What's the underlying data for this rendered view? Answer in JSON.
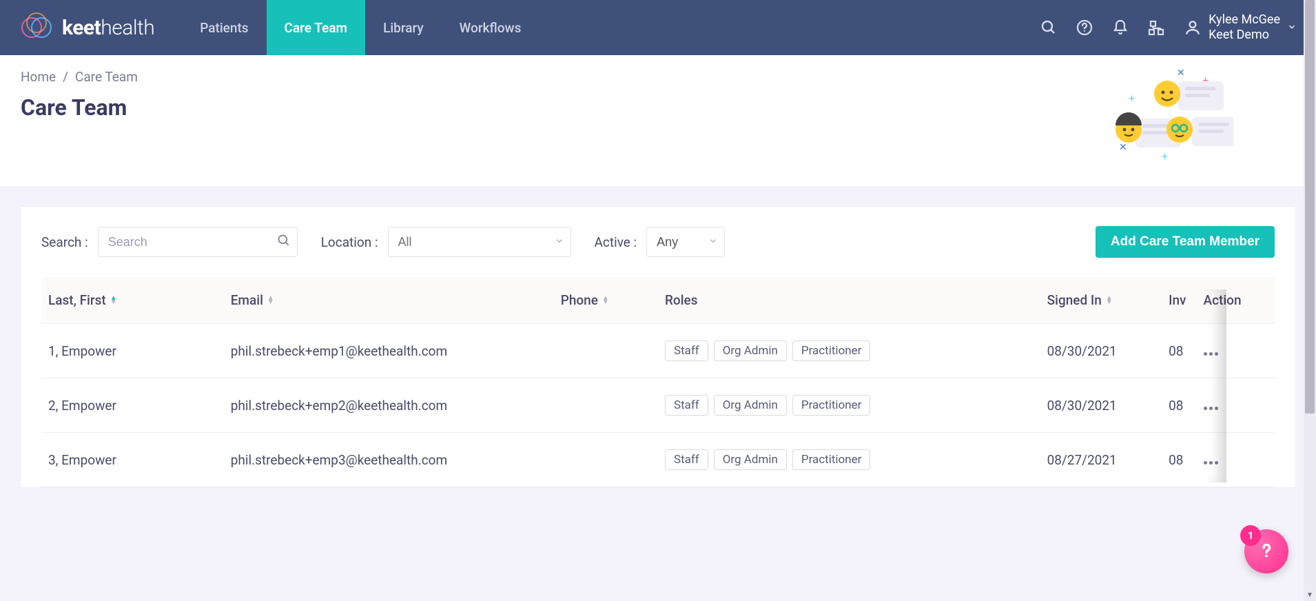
{
  "brand": {
    "bold": "keet",
    "light": "health"
  },
  "nav": {
    "items": [
      {
        "label": "Patients",
        "active": false
      },
      {
        "label": "Care Team",
        "active": true
      },
      {
        "label": "Library",
        "active": false
      },
      {
        "label": "Workflows",
        "active": false
      }
    ]
  },
  "user": {
    "name": "Kylee McGee",
    "org": "Keet Demo"
  },
  "breadcrumb": {
    "home": "Home",
    "sep": "/",
    "current": "Care Team"
  },
  "page": {
    "title": "Care Team"
  },
  "filters": {
    "search_label": "Search :",
    "search_placeholder": "Search",
    "location_label": "Location :",
    "location_placeholder": "All",
    "active_label": "Active :",
    "active_value": "Any",
    "add_button": "Add Care Team Member"
  },
  "table": {
    "columns": {
      "name": "Last, First",
      "email": "Email",
      "phone": "Phone",
      "roles": "Roles",
      "signed_in": "Signed In",
      "invited": "Inv",
      "action": "Action"
    },
    "rows": [
      {
        "name": "1, Empower",
        "email": "phil.strebeck+emp1@keethealth.com",
        "phone": "",
        "roles": [
          "Staff",
          "Org Admin",
          "Practitioner"
        ],
        "signed_in": "08/30/2021",
        "invited": "08"
      },
      {
        "name": "2, Empower",
        "email": "phil.strebeck+emp2@keethealth.com",
        "phone": "",
        "roles": [
          "Staff",
          "Org Admin",
          "Practitioner"
        ],
        "signed_in": "08/30/2021",
        "invited": "08"
      },
      {
        "name": "3, Empower",
        "email": "phil.strebeck+emp3@keethealth.com",
        "phone": "",
        "roles": [
          "Staff",
          "Org Admin",
          "Practitioner"
        ],
        "signed_in": "08/27/2021",
        "invited": "08"
      }
    ]
  },
  "help": {
    "badge": "1"
  }
}
